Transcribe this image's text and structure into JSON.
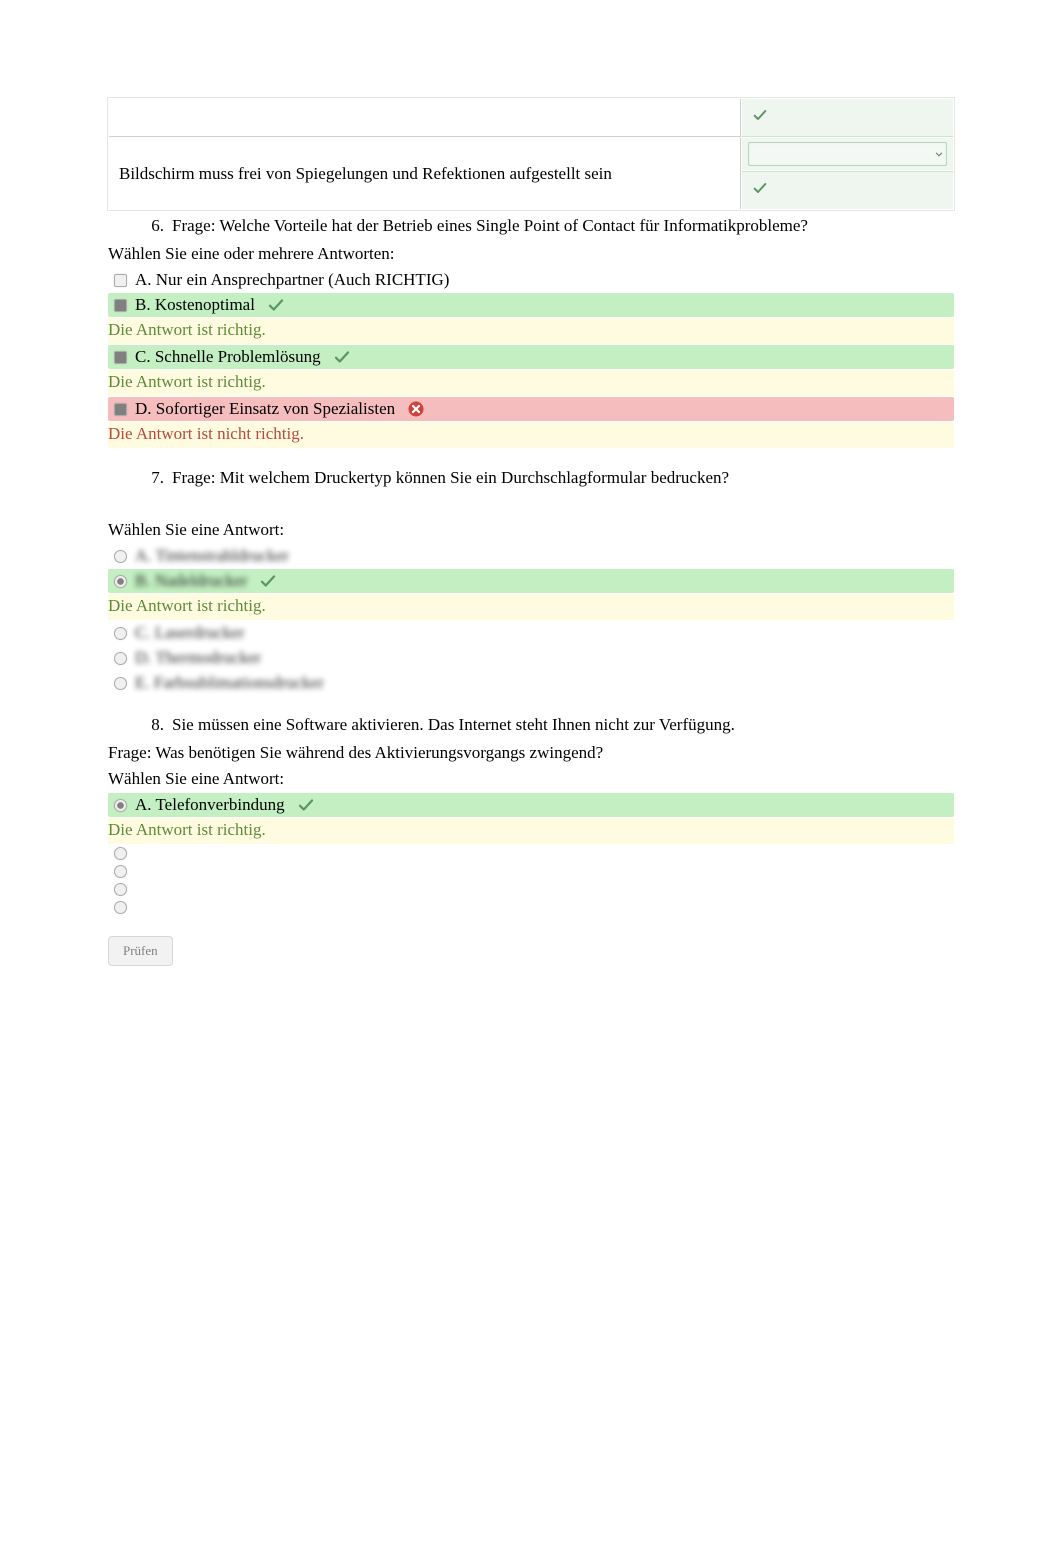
{
  "colors": {
    "correct_bg": "#c3efc2",
    "incorrect_bg": "#f5bdbd",
    "feedback_correct": "#5d8b39",
    "feedback_incorrect": "#b64a3b",
    "match_right_bg": "#eff6f0"
  },
  "match_table": {
    "left_top": "",
    "left_bottom": "Bildschirm muss frei von Spiegelungen und Refektionen aufgestellt sein",
    "right_rows": [
      {
        "text": "",
        "has_select": false
      },
      {
        "text": "",
        "has_select": true
      },
      {
        "text": "",
        "has_select": false
      }
    ]
  },
  "questions": [
    {
      "num": "6.",
      "frage_label": "Frage:",
      "text": "Welche Vorteile hat der Betrieb eines Single Point of Contact für Informatikprobleme?",
      "select_instruction": "Wählen Sie eine oder mehrere Antworten:",
      "type": "multi",
      "answers": [
        {
          "letter": "A.",
          "text": "Nur ein Ansprechpartner (Auch RICHTIG)",
          "checked": false,
          "state": "none",
          "blur": false
        },
        {
          "letter": "B.",
          "text": "Kostenoptimal",
          "checked": true,
          "state": "correct",
          "blur": false,
          "feedback": {
            "kind": "correct",
            "text": "Die Antwort ist richtig."
          }
        },
        {
          "letter": "C.",
          "text": "Schnelle Problemlösung",
          "checked": true,
          "state": "correct",
          "blur": false,
          "feedback": {
            "kind": "correct",
            "text": "Die Antwort ist richtig."
          }
        },
        {
          "letter": "D.",
          "text": "Sofortiger Einsatz von Spezialisten",
          "checked": true,
          "state": "incorrect",
          "blur": false,
          "feedback": {
            "kind": "incorrect",
            "text": "Die Antwort ist nicht richtig."
          }
        }
      ]
    },
    {
      "num": "7.",
      "frage_label": "Frage:",
      "text": "  Mit welchem Druckertyp können Sie ein Durchschlagformular bedrucken?",
      "select_instruction": "Wählen Sie eine Antwort:",
      "type": "single",
      "pre_gap": true,
      "answers": [
        {
          "letter": "A.",
          "text": "Tintenstrahldrucker",
          "checked": false,
          "state": "none",
          "blur": true
        },
        {
          "letter": "B.",
          "text": "Nadeldrucker",
          "checked": true,
          "state": "correct",
          "blur": true,
          "feedback": {
            "kind": "correct",
            "text": "Die Antwort ist richtig."
          }
        },
        {
          "letter": "C.",
          "text": "Laserdrucker",
          "checked": false,
          "state": "none",
          "blur": true
        },
        {
          "letter": "D.",
          "text": "Thermodrucker",
          "checked": false,
          "state": "none",
          "blur": true
        },
        {
          "letter": "E.",
          "text": "Farbsublimationsdrucker",
          "checked": false,
          "state": "none",
          "blur": true
        }
      ]
    },
    {
      "num": "8.",
      "intro": "Sie müssen eine Software aktivieren. Das Internet steht Ihnen nicht zur Verfügung.",
      "frage_label": "Frage:",
      "text": "Was benötigen Sie während des Aktivierungsvorgangs zwingend?",
      "select_instruction": "Wählen Sie eine Antwort:",
      "type": "single",
      "answers": [
        {
          "letter": "A.",
          "text": "Telefonverbindung",
          "checked": true,
          "state": "correct",
          "blur": false,
          "feedback": {
            "kind": "correct",
            "text": "Die Antwort ist richtig."
          }
        },
        {
          "letter": "",
          "text": "",
          "checked": false,
          "state": "none",
          "blur": false,
          "placeholder": true
        },
        {
          "letter": "",
          "text": "",
          "checked": false,
          "state": "none",
          "blur": false,
          "placeholder": true
        },
        {
          "letter": "",
          "text": "",
          "checked": false,
          "state": "none",
          "blur": false,
          "placeholder": true
        },
        {
          "letter": "",
          "text": "",
          "checked": false,
          "state": "none",
          "blur": false,
          "placeholder": true
        }
      ]
    }
  ],
  "button": {
    "label": "Prüfen"
  }
}
